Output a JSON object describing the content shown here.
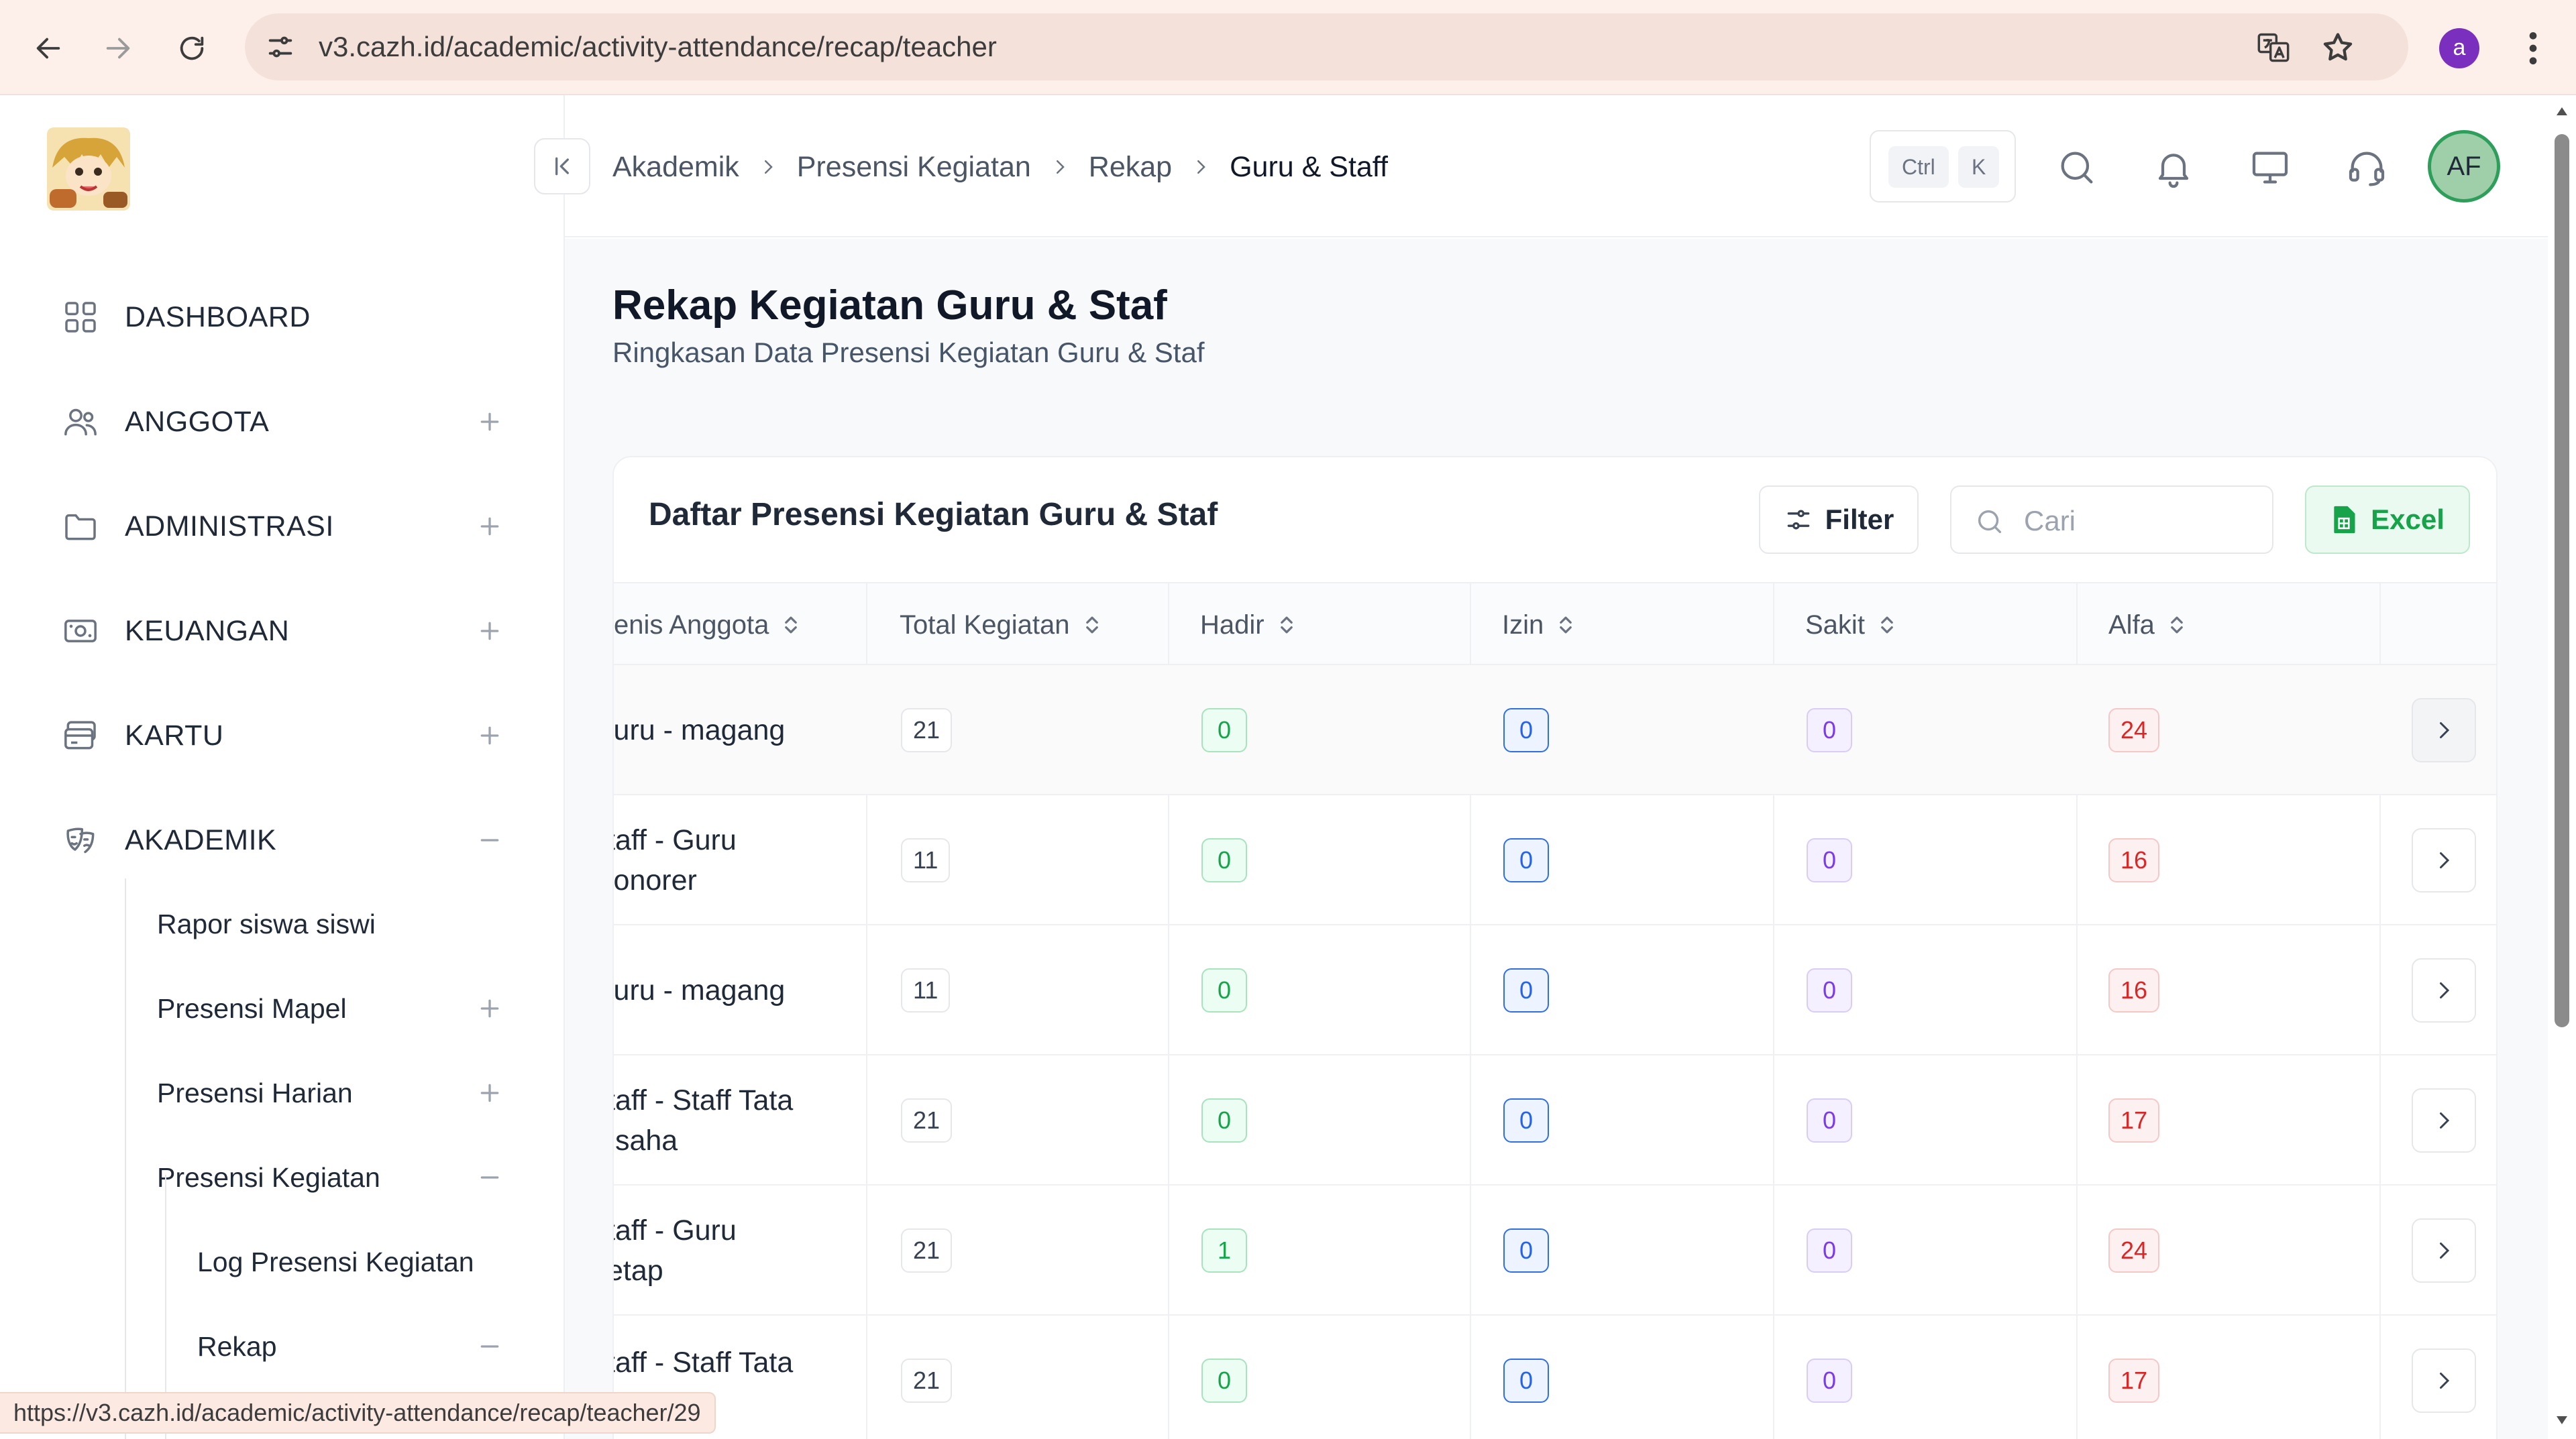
{
  "browser": {
    "url": "v3.cazh.id/academic/activity-attendance/recap/teacher",
    "profile_initial": "a",
    "status_url": "https://v3.cazh.id/academic/activity-attendance/recap/teacher/29"
  },
  "sidebar": {
    "items": [
      {
        "label": "DASHBOARD",
        "icon": "grid-icon"
      },
      {
        "label": "ANGGOTA",
        "icon": "users-icon",
        "expand": "+"
      },
      {
        "label": "ADMINISTRASI",
        "icon": "folder-icon",
        "expand": "+"
      },
      {
        "label": "KEUANGAN",
        "icon": "money-icon",
        "expand": "+"
      },
      {
        "label": "KARTU",
        "icon": "card-icon",
        "expand": "+"
      },
      {
        "label": "AKADEMIK",
        "icon": "mask-icon",
        "expand": "-"
      }
    ],
    "akademik_sub": [
      {
        "label": "Rapor siswa siswi"
      },
      {
        "label": "Presensi Mapel",
        "expand": "+"
      },
      {
        "label": "Presensi Harian",
        "expand": "+"
      },
      {
        "label": "Presensi Kegiatan",
        "expand": "-"
      }
    ],
    "kegiatan_sub": [
      {
        "label": "Log Presensi Kegiatan"
      },
      {
        "label": "Rekap",
        "expand": "-"
      }
    ]
  },
  "header": {
    "breadcrumb": [
      "Akademik",
      "Presensi Kegiatan",
      "Rekap",
      "Guru & Staff"
    ],
    "shortcut": [
      "Ctrl",
      "K"
    ],
    "avatar": "AF"
  },
  "page": {
    "title": "Rekap Kegiatan Guru & Staf",
    "subtitle": "Ringkasan Data Presensi Kegiatan Guru & Staf"
  },
  "card": {
    "title": "Daftar Presensi Kegiatan Guru & Staf",
    "filter_label": "Filter",
    "search_placeholder": "Cari",
    "excel_label": "Excel"
  },
  "table": {
    "columns": [
      "enis Anggota",
      "Total Kegiatan",
      "Hadir",
      "Izin",
      "Sakit",
      "Alfa"
    ],
    "rows": [
      {
        "jenis": [
          "iuru - magang"
        ],
        "total": "21",
        "hadir": "0",
        "izin": "0",
        "sakit": "0",
        "alfa": "24"
      },
      {
        "jenis": [
          "taff - Guru",
          "lonorer"
        ],
        "total": "11",
        "hadir": "0",
        "izin": "0",
        "sakit": "0",
        "alfa": "16"
      },
      {
        "jenis": [
          "iuru - magang"
        ],
        "total": "11",
        "hadir": "0",
        "izin": "0",
        "sakit": "0",
        "alfa": "16"
      },
      {
        "jenis": [
          "taff - Staff Tata",
          "Isaha"
        ],
        "total": "21",
        "hadir": "0",
        "izin": "0",
        "sakit": "0",
        "alfa": "17"
      },
      {
        "jenis": [
          "taff - Guru",
          "etap"
        ],
        "total": "21",
        "hadir": "1",
        "izin": "0",
        "sakit": "0",
        "alfa": "24"
      },
      {
        "jenis": [
          "taff - Staff Tata"
        ],
        "total": "21",
        "hadir": "0",
        "izin": "0",
        "sakit": "0",
        "alfa": "17"
      }
    ]
  },
  "colors": {
    "hadir": "#16a34a",
    "izin": "#2563eb",
    "sakit": "#7c3aed",
    "alfa": "#dc2626",
    "accent_green": "#2e9e5b"
  }
}
